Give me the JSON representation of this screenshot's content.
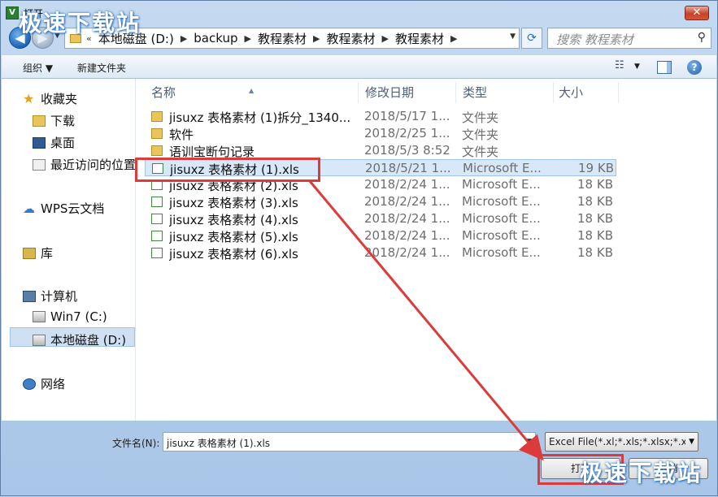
{
  "window": {
    "title": "打开",
    "close_label": "✕"
  },
  "watermark": "极速下载站",
  "navbar": {
    "back_label": "◀",
    "forward_label": "▶",
    "breadcrumb_prefix": "«",
    "breadcrumb": [
      "本地磁盘 (D:)",
      "backup",
      "教程素材",
      "教程素材",
      "教程素材"
    ],
    "search_placeholder": "搜索 教程素材"
  },
  "toolbar": {
    "organize_label": "组织 ▼",
    "new_folder_label": "新建文件夹"
  },
  "sidebar": {
    "favorites": "收藏夹",
    "downloads": "下载",
    "desktop": "桌面",
    "recent": "最近访问的位置",
    "wps": "WPS云文档",
    "libraries": "库",
    "computer": "计算机",
    "drive_c": "Win7 (C:)",
    "drive_d": "本地磁盘 (D:)",
    "network": "网络"
  },
  "columns": {
    "name": "名称",
    "date": "修改日期",
    "type": "类型",
    "size": "大小"
  },
  "files": [
    {
      "name": "jisuxz 表格素材 (1)拆分_1340...",
      "date": "2018/5/17 1...",
      "type": "文件夹",
      "size": "",
      "kind": "folder"
    },
    {
      "name": "软件",
      "date": "2018/2/25 1...",
      "type": "文件夹",
      "size": "",
      "kind": "folder"
    },
    {
      "name": "语训宝断句记录",
      "date": "2018/5/3 8:52",
      "type": "文件夹",
      "size": "",
      "kind": "folder"
    },
    {
      "name": "jisuxz 表格素材 (1).xls",
      "date": "2018/5/21 1...",
      "type": "Microsoft E...",
      "size": "19 KB",
      "kind": "xls"
    },
    {
      "name": "jisuxz 表格素材 (2).xls",
      "date": "2018/2/24 1...",
      "type": "Microsoft E...",
      "size": "18 KB",
      "kind": "xls"
    },
    {
      "name": "jisuxz 表格素材 (3).xls",
      "date": "2018/2/24 1...",
      "type": "Microsoft E...",
      "size": "18 KB",
      "kind": "xls"
    },
    {
      "name": "jisuxz 表格素材 (4).xls",
      "date": "2018/2/24 1...",
      "type": "Microsoft E...",
      "size": "18 KB",
      "kind": "xls"
    },
    {
      "name": "jisuxz 表格素材 (5).xls",
      "date": "2018/2/24 1...",
      "type": "Microsoft E...",
      "size": "18 KB",
      "kind": "xls"
    },
    {
      "name": "jisuxz 表格素材 (6).xls",
      "date": "2018/2/24 1...",
      "type": "Microsoft E...",
      "size": "18 KB",
      "kind": "xls"
    }
  ],
  "selected_index": 3,
  "bottom": {
    "filename_label": "文件名(N):",
    "filename_value": "jisuxz 表格素材 (1).xls",
    "filter_value": "Excel File(*.xl;*.xls;*.xlsx;*.xlsm",
    "open_label": "打开",
    "cancel_label": "取消"
  },
  "colors": {
    "highlight": "#dd3b3b",
    "selection": "#d9e8f9"
  }
}
